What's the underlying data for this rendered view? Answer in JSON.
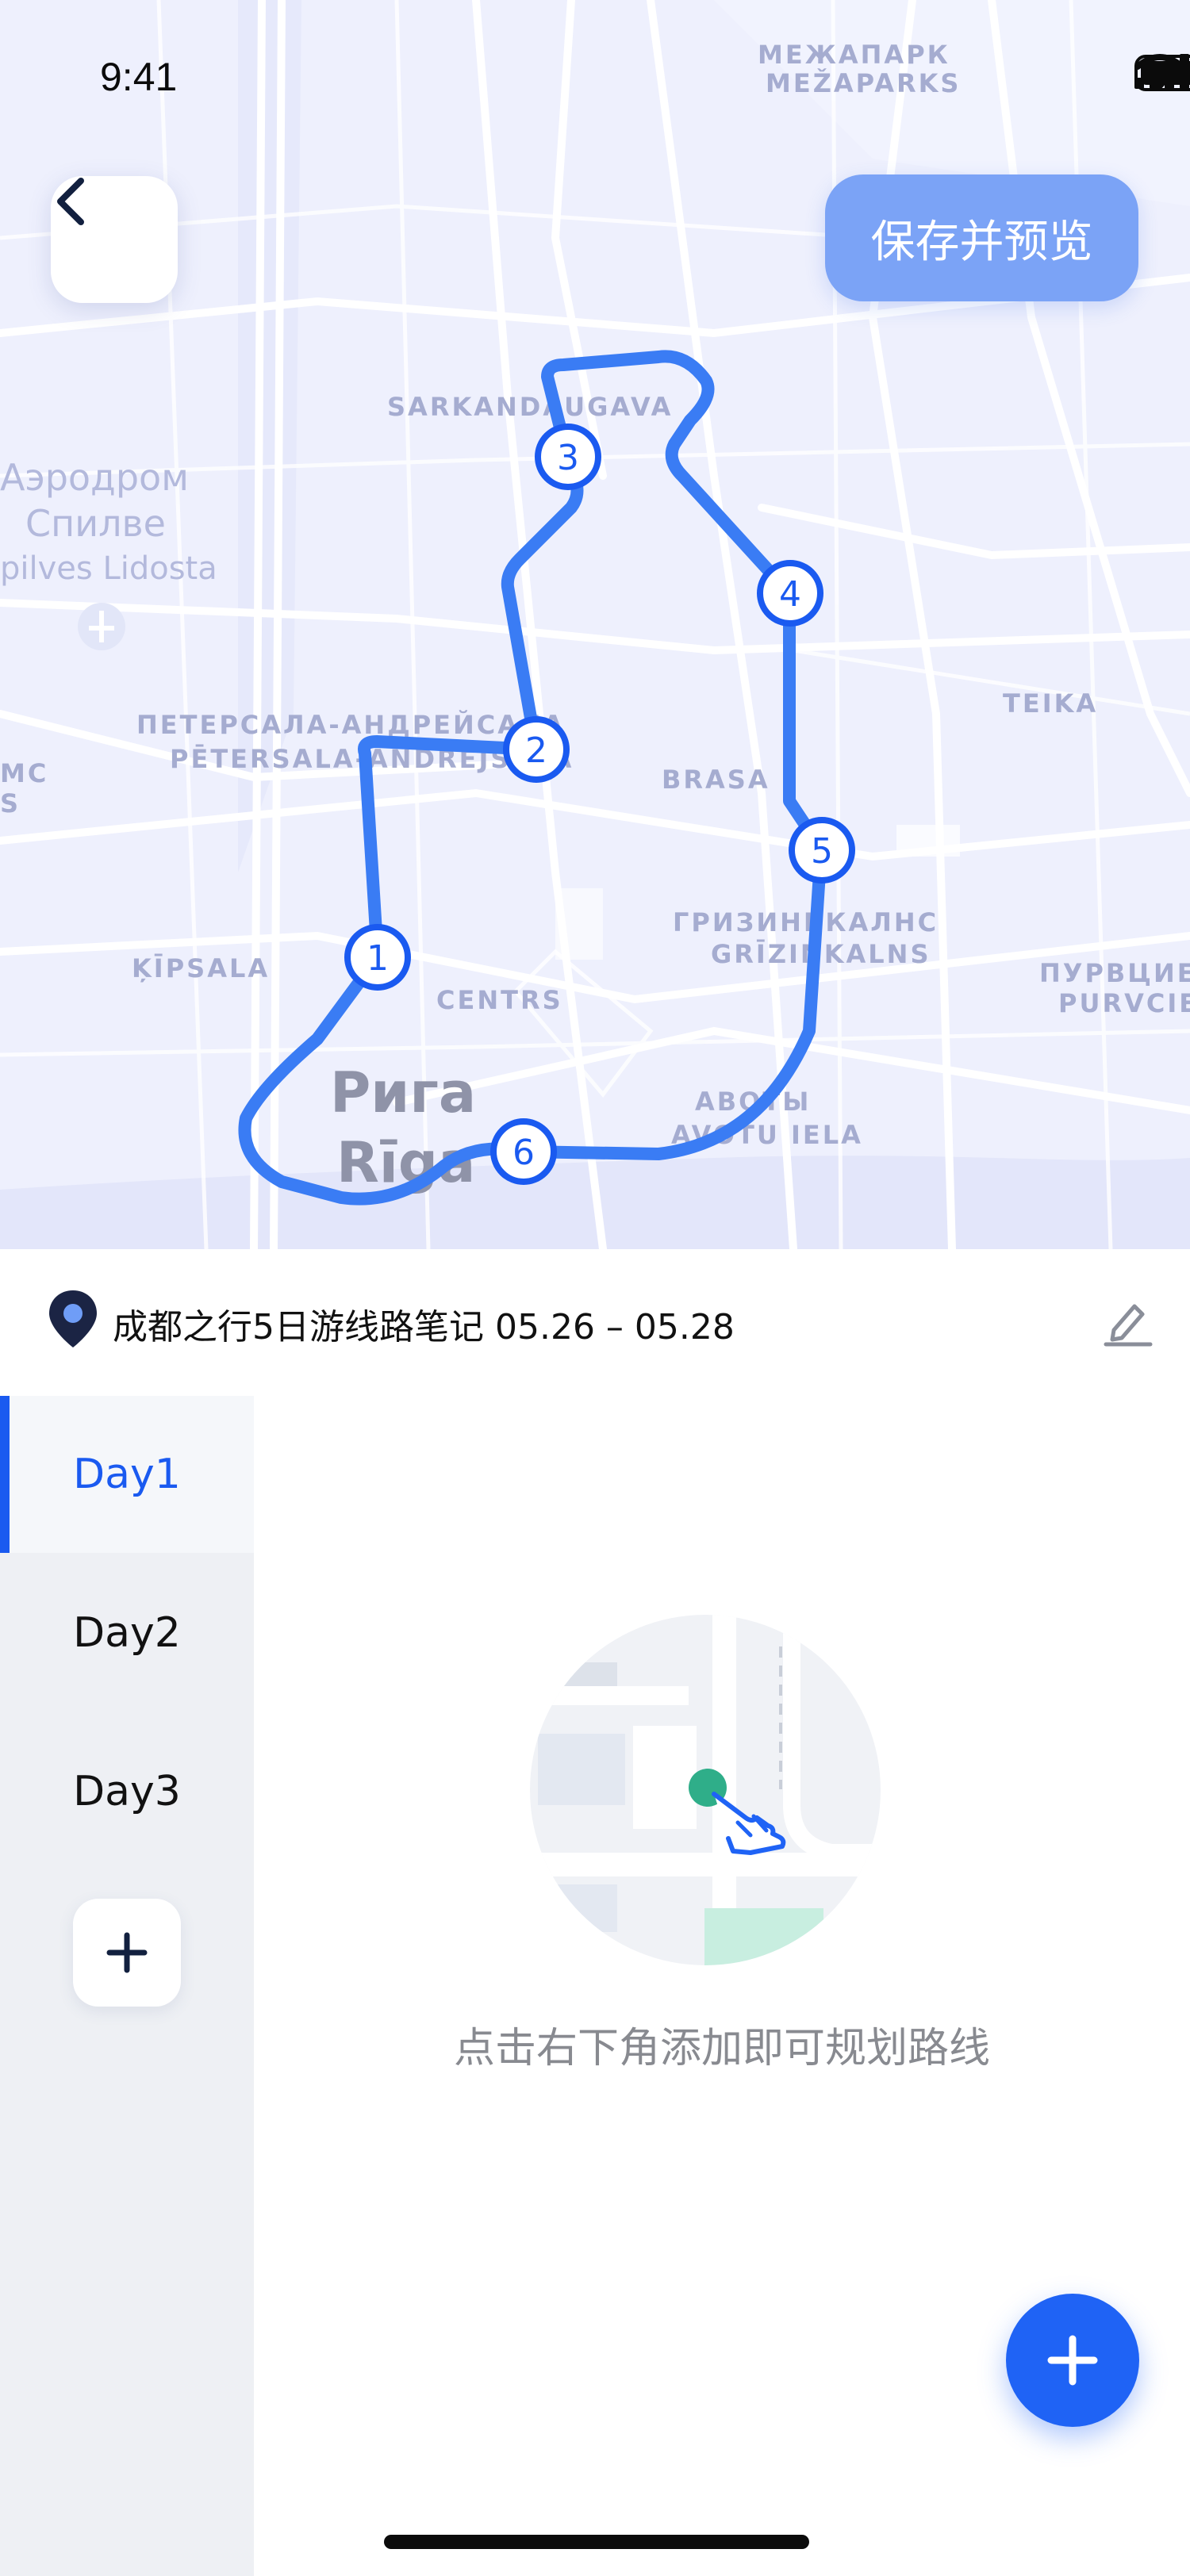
{
  "status_bar": {
    "time": "9:41"
  },
  "header": {
    "save_button_label": "保存并预览"
  },
  "map": {
    "labels": [
      "МЕЖАПАРК",
      "MEŽAPARKS",
      "SARKANDAUGAVA",
      "Аэродром",
      "Спилве",
      "pilves Lidosta",
      "ПЕТЕРСАЛА-АНДРЕЙСАЛА",
      "PĒTERSALA-ANDREJSALA",
      "BRASA",
      "TEIKA",
      "ГРИЗИНЬКАЛНС",
      "GRĪZIŅKALNS",
      "ĶĪPSALA",
      "CENTRS",
      "ПУРВЦИЕМС",
      "PURVCIEMS",
      "Рига",
      "Rīga",
      "АВОТЫ",
      "AVOTU IELA",
      "МС",
      "S"
    ],
    "route_markers": [
      "1",
      "2",
      "3",
      "4",
      "5",
      "6"
    ],
    "route_color": "#3a7cf4"
  },
  "trip": {
    "title": "成都之行5日游线路笔记 05.26 – 05.28"
  },
  "days": [
    {
      "label": "Day1",
      "active": true
    },
    {
      "label": "Day2",
      "active": false
    },
    {
      "label": "Day3",
      "active": false
    }
  ],
  "empty_state": {
    "message": "点击右下角添加即可规划路线"
  },
  "colors": {
    "accent": "#1a5af0",
    "save_button": "#7ba3f6",
    "sidebar_bg": "#eef0f4"
  },
  "icons": [
    "back-chevron-icon",
    "signal-icon",
    "wifi-icon",
    "battery-icon",
    "location-pin-icon",
    "edit-pencil-icon",
    "plus-icon",
    "tap-hand-icon"
  ]
}
